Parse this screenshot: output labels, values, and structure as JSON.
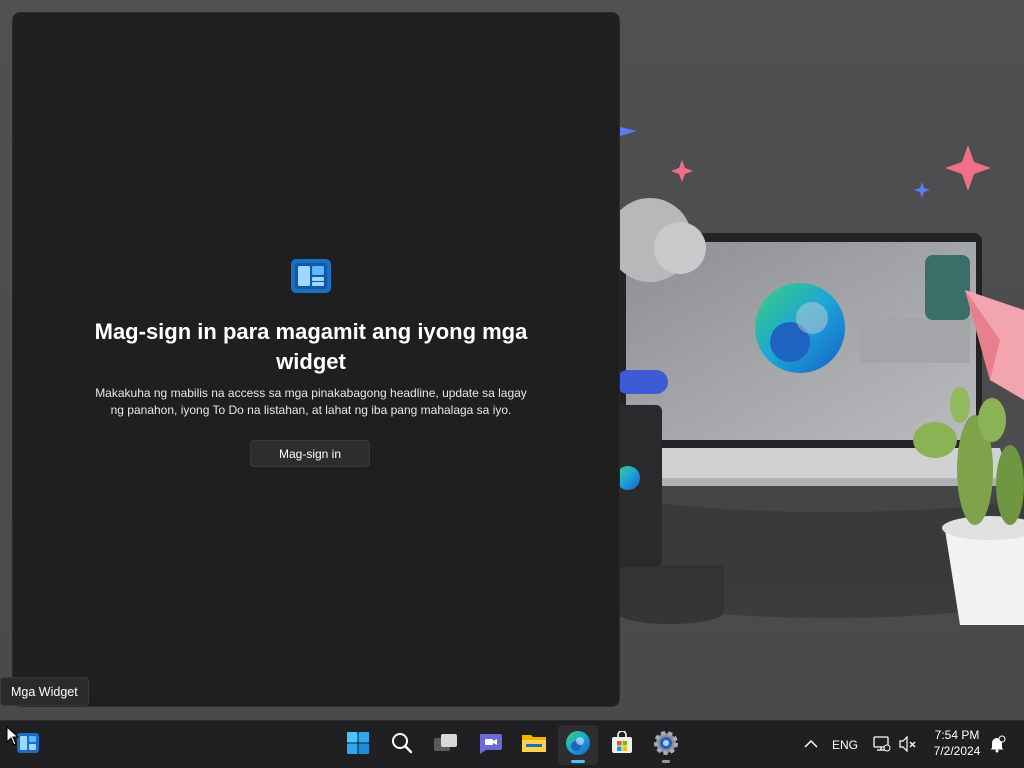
{
  "widgets_panel": {
    "title": "Mag-sign in para magamit ang iyong mga widget",
    "description": "Makakuha ng mabilis na access sa mga pinakabagong headline, update sa lagay ng panahon, iyong To Do na listahan, at lahat ng iba pang mahalaga sa iyo.",
    "signin_label": "Mag-sign in"
  },
  "tooltip": {
    "text": "Mga Widget"
  },
  "taskbar": {
    "items": [
      {
        "name": "widgets-icon",
        "active": false
      },
      {
        "name": "windows-start-icon",
        "active": false
      },
      {
        "name": "search-icon",
        "active": false
      },
      {
        "name": "task-view-icon",
        "active": false
      },
      {
        "name": "chat-icon",
        "active": false
      },
      {
        "name": "file-explorer-icon",
        "active": false
      },
      {
        "name": "edge-browser-icon",
        "active": true
      },
      {
        "name": "microsoft-store-icon",
        "active": false
      },
      {
        "name": "settings-icon",
        "active": false
      }
    ],
    "tray": {
      "overflow_icon": "chevron-up-icon",
      "language": "ENG",
      "network_icon": "network-icon",
      "volume_icon": "volume-muted-icon",
      "time": "7:54 PM",
      "date": "7/2/2024",
      "notification_icon": "notification-bell-icon"
    }
  },
  "colors": {
    "panel_bg": "#1f1f20",
    "taskbar_bg": "#202022",
    "accent": "#4cc2ff",
    "wallpaper_bg": "#4c4c4e"
  }
}
